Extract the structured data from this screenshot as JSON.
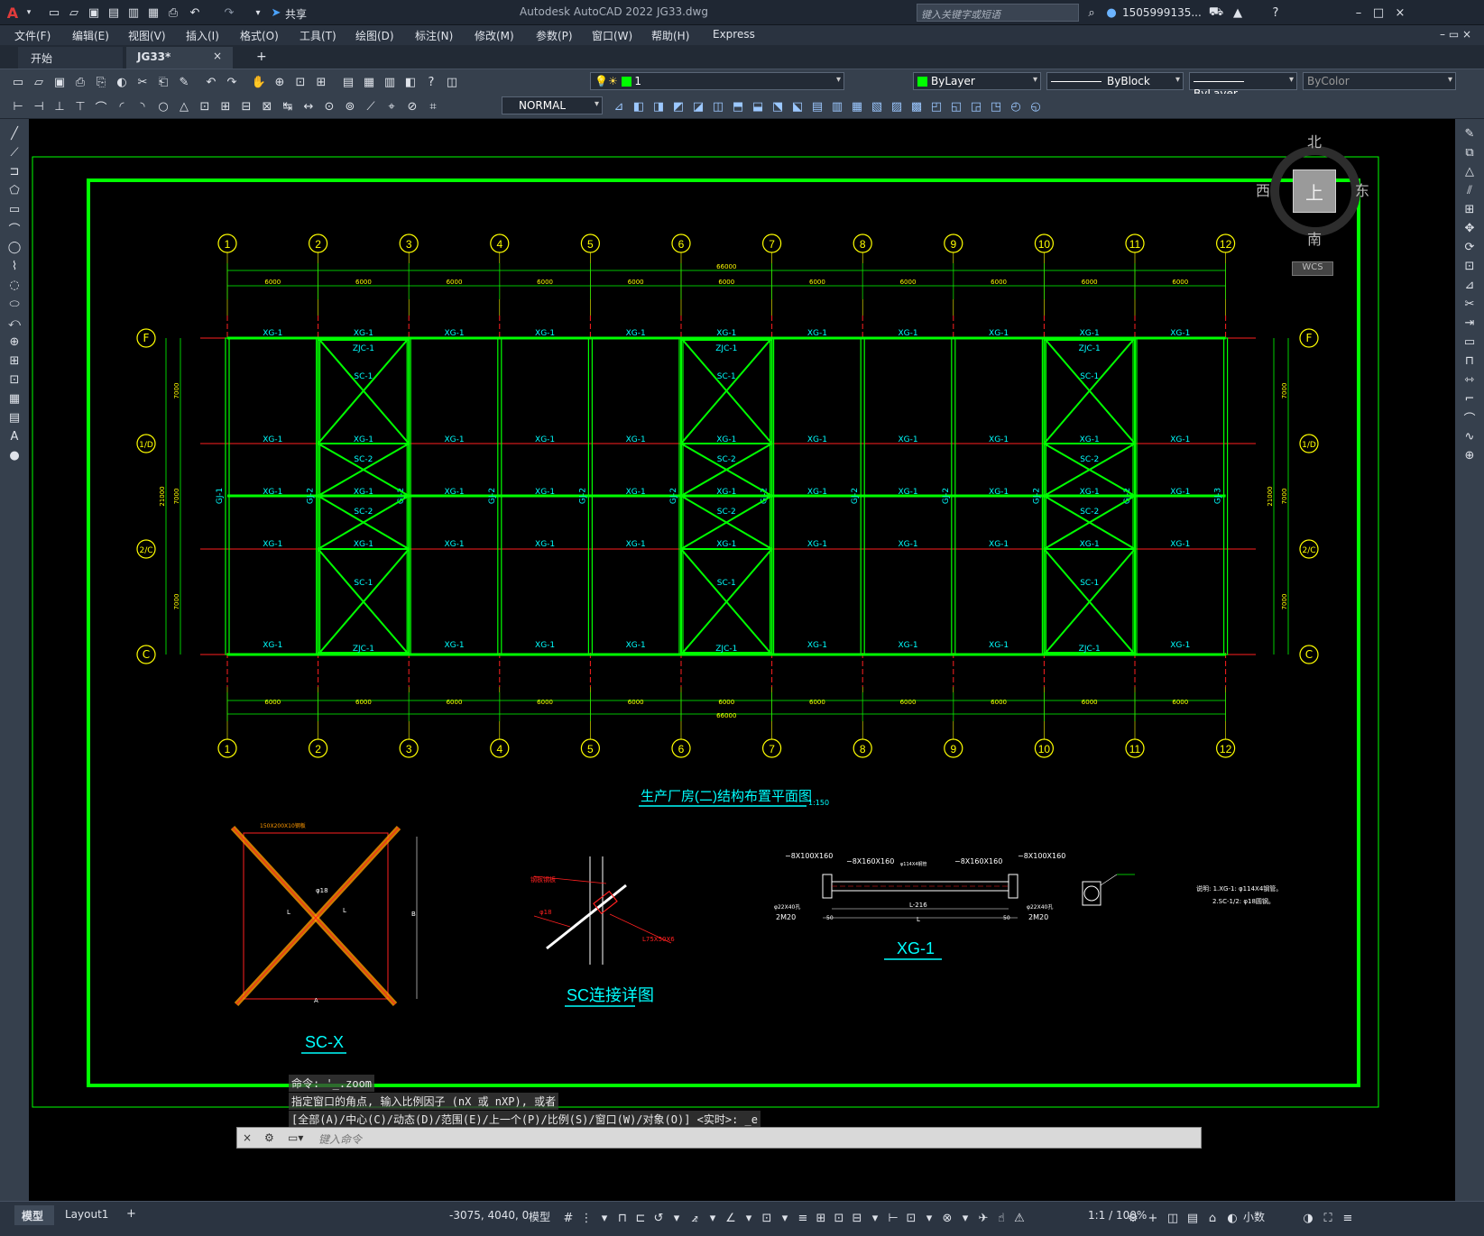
{
  "app": {
    "title": "Autodesk AutoCAD 2022",
    "filename": "JG33.dwg",
    "share_label": "共享",
    "search_placeholder": "键入关键字或短语",
    "user": "1505999135...",
    "window_controls": [
      "–",
      "□",
      "×"
    ]
  },
  "menu": [
    "文件(F)",
    "编辑(E)",
    "视图(V)",
    "插入(I)",
    "格式(O)",
    "工具(T)",
    "绘图(D)",
    "标注(N)",
    "修改(M)",
    "参数(P)",
    "窗口(W)",
    "帮助(H)",
    "Express"
  ],
  "tabs": [
    {
      "label": "开始",
      "active": false
    },
    {
      "label": "JG33*",
      "active": true
    }
  ],
  "tab_close": "×",
  "tab_add": "+",
  "layer": {
    "name": "1",
    "color": "#00ff00"
  },
  "properties": {
    "color": "ByLayer",
    "linetype": "ByBlock",
    "lineweight": "ByLayer",
    "plotstyle": "ByColor"
  },
  "dimstyle": "NORMAL",
  "viewcube": {
    "north": "北",
    "south": "南",
    "east": "东",
    "west": "西",
    "top": "上",
    "wcs": "WCS"
  },
  "drawing": {
    "grid_x_labels": [
      "1",
      "2",
      "3",
      "4",
      "5",
      "6",
      "7",
      "8",
      "9",
      "10",
      "11",
      "12"
    ],
    "grid_y_labels": [
      "F",
      "1/D",
      "2/C",
      "C"
    ],
    "bay_dim": "6000",
    "total_dim": "66000",
    "side_dims": [
      "7000",
      "7000",
      "7000"
    ],
    "side_total": "21000",
    "member_xg": "XG-1",
    "member_zjc": "ZJC-1",
    "member_sc1": "SC-1",
    "member_sc2": "SC-2",
    "gj_labels": [
      "GJ-1",
      "GJ-2",
      "GJ-2",
      "GJ-2",
      "GJ-2",
      "GJ-2",
      "GJ-2",
      "GJ-2",
      "GJ-2",
      "GJ-2",
      "GJ-2",
      "GJ-3"
    ],
    "plan_title": "生产厂房(二)结构布置平面图",
    "plan_scale": "1:150",
    "detail1_title": "SC-X",
    "detail2_title": "SC连接详图",
    "detail3_title": "XG-1",
    "xg_notes": [
      "−8X100X160",
      "−8X160X160",
      "φ114X4钢管",
      "−8X160X160",
      "−8X100X160"
    ],
    "xg_dims": [
      "L-216",
      "L",
      "50",
      "50"
    ],
    "xg_bolts": [
      "2M20",
      "2M20"
    ],
    "xg_holes": [
      "φ22X40孔",
      "φ22X40孔"
    ],
    "remarks": [
      "说明: 1.XG-1: φ114X4钢管。",
      "2.SC-1/2: φ18圆钢。"
    ],
    "sc_labels": [
      "φ18",
      "L",
      "L",
      "B",
      "A",
      "150X200X10钢板"
    ],
    "scd_labels": [
      "钢板钢板",
      "φ18",
      "L75X50X6"
    ]
  },
  "command": {
    "history": [
      "命令: '_.zoom",
      "指定窗口的角点, 输入比例因子 (nX 或 nXP), 或者",
      "[全部(A)/中心(C)/动态(D)/范围(E)/上一个(P)/比例(S)/窗口(W)/对象(O)] <实时>: _e"
    ],
    "placeholder": "键入命令"
  },
  "layout_tabs": [
    "模型",
    "Layout1"
  ],
  "status": {
    "coords": "-3075, 4040, 0",
    "space": "模型",
    "scale": "1:1 / 100%",
    "units": "小数"
  }
}
